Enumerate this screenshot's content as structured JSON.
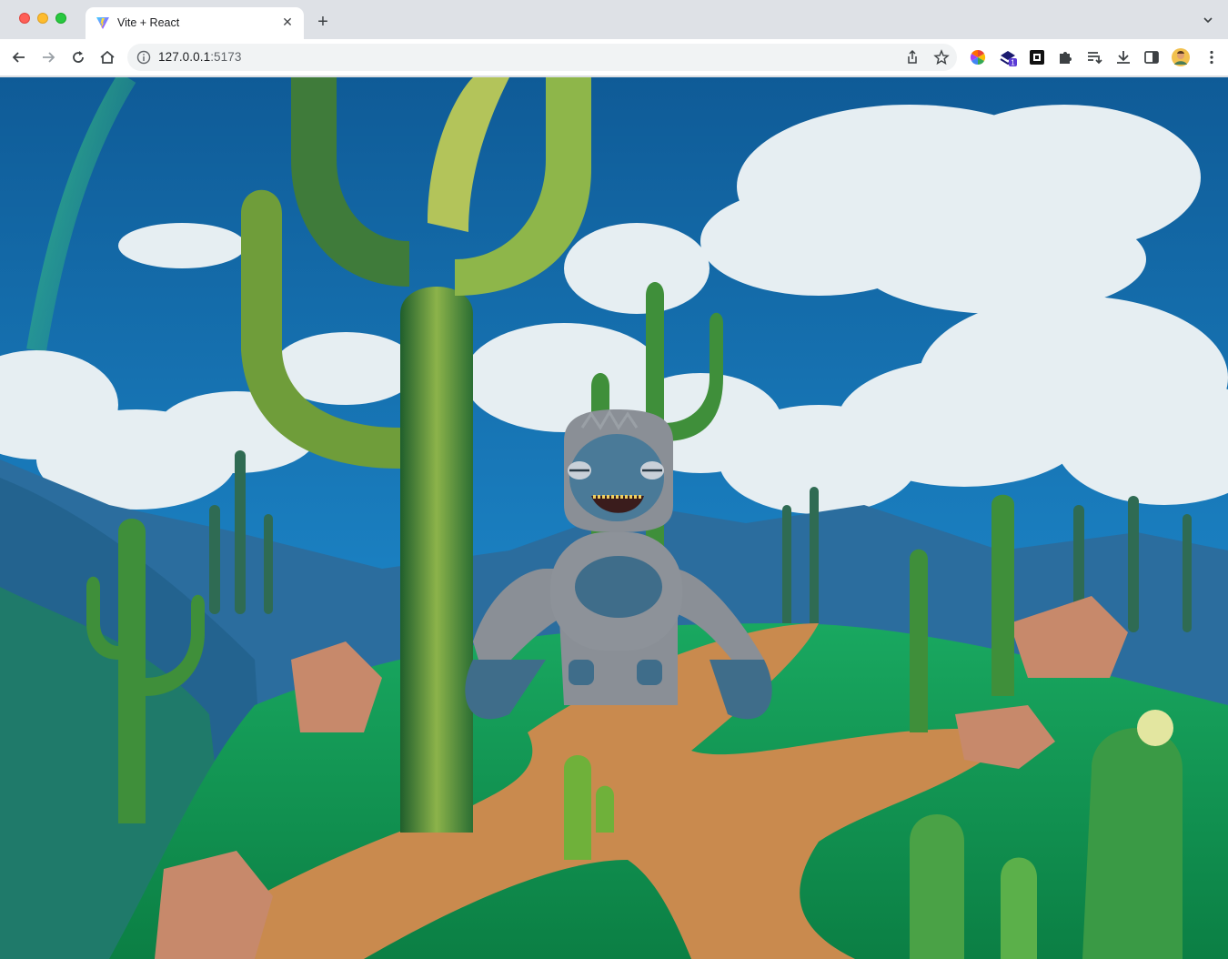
{
  "tab": {
    "title": "Vite + React",
    "close_glyph": "✕"
  },
  "newtab_glyph": "+",
  "address": {
    "host": "127.0.0.1",
    "port": ":5173"
  },
  "icons": {
    "back": "arrow-left-icon",
    "forward": "arrow-right-icon",
    "reload": "reload-icon",
    "home": "home-icon",
    "info": "info-icon",
    "share": "share-icon",
    "bookmark": "star-icon",
    "extensions": [
      "color-wheel-extension-icon",
      "stack-extension-icon",
      "square-extension-icon",
      "puzzle-extensions-icon"
    ],
    "reading_list": "reading-list-icon",
    "download": "download-icon",
    "sidepanel": "side-panel-icon",
    "profile": "profile-avatar",
    "menu": "kebab-menu-icon"
  },
  "extension_badge": "1",
  "scene": {
    "description_colors": {
      "sky": "#1f6fb0",
      "grass": "#16a35a",
      "path": "#c98a4e",
      "cactus": "#3f8f3a",
      "character": "#8a8f96"
    }
  }
}
